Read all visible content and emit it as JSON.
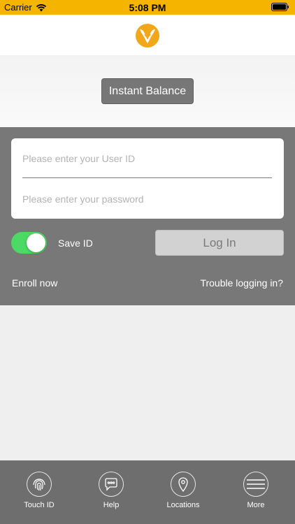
{
  "status_bar": {
    "carrier": "Carrier",
    "time": "5:08 PM",
    "icons": [
      "wifi-icon",
      "battery-icon"
    ],
    "background": "#f4b400"
  },
  "header": {
    "logo": "bank-logo-icon",
    "logo_color": "#f0a81a"
  },
  "instant_balance": {
    "label": "Instant Balance"
  },
  "login": {
    "user_id_placeholder": "Please enter your User ID",
    "password_placeholder": "Please enter your password",
    "save_id_label": "Save ID",
    "save_id_on": true,
    "login_label": "Log In",
    "enroll_label": "Enroll now",
    "trouble_label": "Trouble logging in?"
  },
  "tabs": [
    {
      "label": "Touch ID",
      "icon": "fingerprint-icon"
    },
    {
      "label": "Help",
      "icon": "chat-bubble-icon"
    },
    {
      "label": "Locations",
      "icon": "location-pin-icon"
    },
    {
      "label": "More",
      "icon": "menu-icon"
    }
  ],
  "colors": {
    "panel": "#787878",
    "toggle_on": "#4cd964",
    "tab_bar": "#6e6e6e"
  }
}
